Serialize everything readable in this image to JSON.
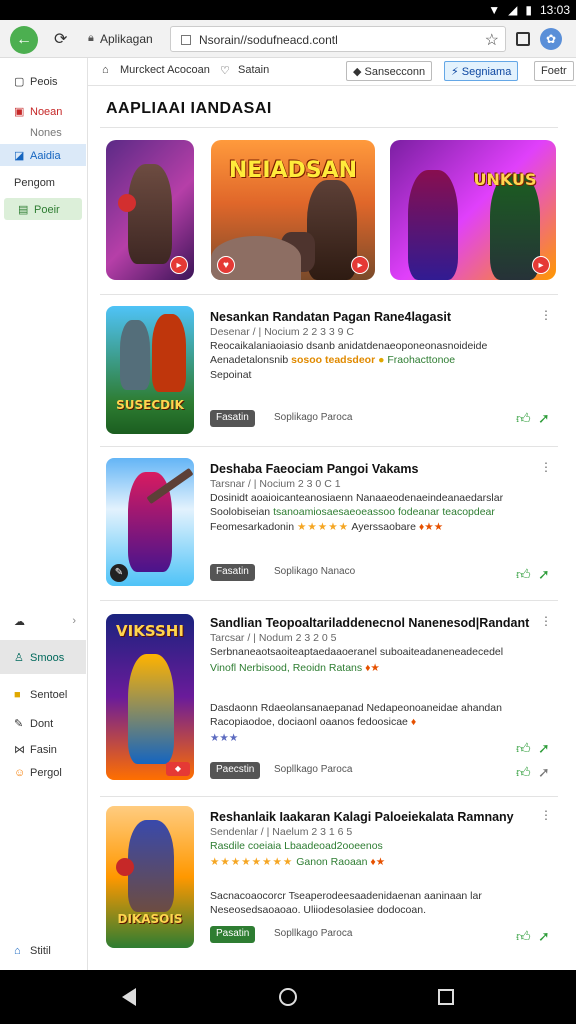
{
  "status": {
    "time": "13:03"
  },
  "browser": {
    "tab_title": "Aplikagan",
    "url": "Nsorain//sodufneacd.contl"
  },
  "sidebar": {
    "items": [
      {
        "label": "Peois"
      },
      {
        "label": "Noean"
      },
      {
        "label": "Nones"
      },
      {
        "label": "Aaidia"
      },
      {
        "label": "Pengom"
      },
      {
        "label": "Poeir"
      },
      {
        "label": "Smoos"
      },
      {
        "label": "Sentoel"
      },
      {
        "label": "Dont"
      },
      {
        "label": "Fasin"
      },
      {
        "label": "Pergol"
      },
      {
        "label": "Stitil"
      }
    ]
  },
  "toolbar": {
    "item1": "Murckect Acocoan",
    "item2": "Satain",
    "btn1": "Sansecconn",
    "btn2": "Segniama",
    "btn3": "Foetr"
  },
  "page": {
    "heading": "AAPLIAAI IANDASAI"
  },
  "banners": [
    {
      "text": ""
    },
    {
      "text": "NEIADSAN"
    },
    {
      "text": "UNKUS"
    }
  ],
  "cards": [
    {
      "thumb_text": "SUSECDIK",
      "title": "Nesankan Randatan Pagan Rane4lagasit",
      "meta": "Desenar / | Nocium 2 2 3 3 9 C",
      "line1": "Reocaikalaniaoiasio dsanb anidatdenaeoponeonasnoideide",
      "line2_a": "Aenadetalonsnib",
      "line2_hl": "sosoo teadsdeor",
      "line2_b": "Fraohacttonoe",
      "line3": "Sepoinat",
      "tag": "Fasatin",
      "sub": "Soplikago Paroca"
    },
    {
      "thumb_text": "",
      "title": "Deshaba Faeociam Pangoi Vakams",
      "meta": "Tarsnar / | Nocium 2 3 0 C 1",
      "line1": "Dosinidt aoaioicanteanosiaenn Nanaaeodenaeindeanaedarslar",
      "line2_a": "Soolobiseian",
      "line2_gr": "tsanoamiosaesaeoeassoo fodeanar teacopdear",
      "line3_a": "Feomesarkadonin",
      "line3_stars": "★★★★★",
      "line3_b": "Ayerssaobare",
      "tag": "Fasatin",
      "sub": "Soplikago Nanaco"
    },
    {
      "thumb_text": "VIKSSHI",
      "title": "Sandlian Teopoaltariladdenecnol Nanenesod|Randant",
      "meta": "Tarcsar / | Nodum 2 3 2 0 5",
      "line1": "Serbnaneaotsaoiteaptaedaaoeranel suboaiteadaneneadecedel",
      "line2": "Vinofl Nerbisood, Reoidn Ratans",
      "line3": "Dasdaonn Rdaeolansanaepanad Nedapeonoaneidae ahandan",
      "line4": "Racopiaodoe, dociaonl oaanos fedoosicae",
      "line5": "★★★",
      "tag": "Paecstin",
      "sub": "Sopllkago Paroca"
    },
    {
      "thumb_text": "DIKASOIS",
      "title": "Reshanlaik Iaakaran Kalagi Paloeiekalata Ramnany",
      "meta": "Sendenlar / | Naelum 2 3 1 6 5",
      "line1": "Rasdile coeiaia Lbaadeoad2ooeenos",
      "line2_stars": "★★★★★★★★",
      "line2_a": "Ganon Raoaan",
      "line3": "Sacnacoaocorcr Tseaperodeesaadenidaenan aaninaan lar",
      "line4": "Neseosedsaoaoao. Uliiodesolasiee dodocoan.",
      "tag": "Pasatin",
      "sub": "Sopllkago Paroca"
    }
  ]
}
